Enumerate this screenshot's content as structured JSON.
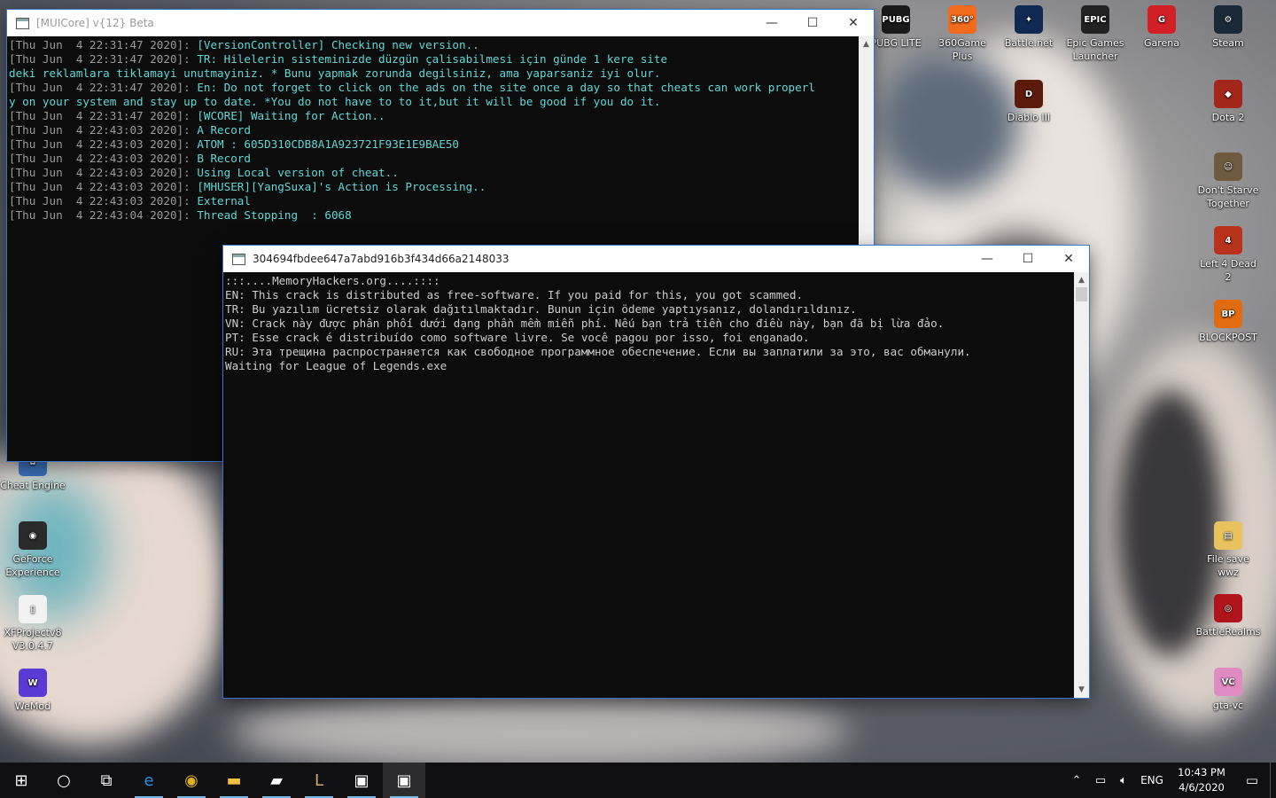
{
  "desktop": {
    "icons_right": [
      {
        "label": "PUBG LITE",
        "icon": "pubg-icon",
        "color": "#1a1a1a",
        "glyph": "PUBG"
      },
      {
        "label": "360Game Plus",
        "icon": "360game-icon",
        "color": "#f26a1b",
        "glyph": "360°"
      },
      {
        "label": "Battle.net",
        "icon": "battlenet-icon",
        "color": "#0e2a52",
        "glyph": "✦"
      },
      {
        "label": "Epic Games Launcher",
        "icon": "epic-games-icon",
        "color": "#222222",
        "glyph": "EPIC"
      },
      {
        "label": "Garena",
        "icon": "garena-icon",
        "color": "#d31f26",
        "glyph": "G"
      },
      {
        "label": "Steam",
        "icon": "steam-icon",
        "color": "#1b2838",
        "glyph": "⚙"
      },
      {
        "label": "Diablo III",
        "icon": "diablo-icon",
        "color": "#5b1a0c",
        "glyph": "D"
      },
      {
        "label": "Dota 2",
        "icon": "dota-icon",
        "color": "#a3261b",
        "glyph": "◆"
      },
      {
        "label": "Don't Starve Together",
        "icon": "dont-starve-icon",
        "color": "#6e5a3e",
        "glyph": "☺"
      },
      {
        "label": "Left 4 Dead 2",
        "icon": "left4dead-icon",
        "color": "#b8321c",
        "glyph": "4"
      },
      {
        "label": "BLOCKPOST",
        "icon": "blockpost-icon",
        "color": "#e06b10",
        "glyph": "BP"
      },
      {
        "label": "File save wwz",
        "icon": "folder-icon",
        "color": "#e8c25c",
        "glyph": "▤"
      },
      {
        "label": "BattleRealms",
        "icon": "battlerealms-icon",
        "color": "#b0141a",
        "glyph": "◎"
      },
      {
        "label": "gta-vc",
        "icon": "gta-vc-icon",
        "color": "#e18bc4",
        "glyph": "VC"
      }
    ],
    "icons_left": [
      {
        "label": "Cheat Engine",
        "icon": "cheat-engine-icon",
        "color": "#3a6fb8",
        "glyph": "✿"
      },
      {
        "label": "GeForce Experience",
        "icon": "geforce-icon",
        "color": "#2a2a2a",
        "glyph": "◉"
      },
      {
        "label": "XFProjectv8 V3.0.4.7",
        "icon": "file-icon",
        "color": "#f2f2f2",
        "glyph": "▯"
      },
      {
        "label": "WeMod",
        "icon": "wemod-icon",
        "color": "#5b3bd6",
        "glyph": "W"
      }
    ]
  },
  "window1": {
    "title": "[MUICore] v{12} Beta",
    "lines": [
      {
        "ts": "[Thu Jun  4 22:31:47 2020]: ",
        "msg": "[VersionController] Checking new version.."
      },
      {
        "ts": "[Thu Jun  4 22:31:47 2020]: ",
        "msg": "TR: Hilelerin sisteminizde düzgün çalisabilmesi için günde 1 kere site"
      },
      {
        "ts": "",
        "msg": "deki reklamlara tiklamayi unutmayiniz. * Bunu yapmak zorunda degilsiniz, ama yaparsaniz iyi olur."
      },
      {
        "ts": "[Thu Jun  4 22:31:47 2020]: ",
        "msg": "En: Do not forget to click on the ads on the site once a day so that cheats can work properl"
      },
      {
        "ts": "",
        "msg": "y on your system and stay up to date. *You do not have to to it,but it will be good if you do it."
      },
      {
        "ts": "[Thu Jun  4 22:31:47 2020]: ",
        "msg": "[WCORE] Waiting for Action.."
      },
      {
        "ts": "[Thu Jun  4 22:43:03 2020]: ",
        "msg": "A Record"
      },
      {
        "ts": "[Thu Jun  4 22:43:03 2020]: ",
        "msg": "ATOM : 605D310CDB8A1A923721F93E1E9BAE50"
      },
      {
        "ts": "[Thu Jun  4 22:43:03 2020]: ",
        "msg": "B Record"
      },
      {
        "ts": "[Thu Jun  4 22:43:03 2020]: ",
        "msg": "Using Local version of cheat.."
      },
      {
        "ts": "[Thu Jun  4 22:43:03 2020]: ",
        "msg": "[MHUSER][YangSuxa]'s Action is Processing.."
      },
      {
        "ts": "[Thu Jun  4 22:43:03 2020]: ",
        "msg": "External"
      },
      {
        "ts": "[Thu Jun  4 22:43:04 2020]: ",
        "msg": "Thread Stopping  : 6068"
      }
    ]
  },
  "window2": {
    "title": "304694fbdee647a7abd916b3f434d66a2148033",
    "lines": [
      ":::....MemoryHackers.org....::::",
      "EN: This crack is distributed as free-software. If you paid for this, you got scammed.",
      "TR: Bu yazılım ücretsiz olarak dağıtılmaktadır. Bunun için ödeme yaptıysanız, dolandırıldınız.",
      "VN: Crack này được phân phối dưới dạng phần mềm miễn phí. Nếu bạn trả tiền cho điều này, bạn đã bị lừa đảo.",
      "PT: Esse crack é distribuído como software livre. Se você pagou por isso, foi enganado.",
      "RU: Эта трещина распространяется как свободное программное обеспечение. Если вы заплатили за это, вас обманули.",
      "Waiting for League of Legends.exe"
    ]
  },
  "window_controls": {
    "minimize": "—",
    "maximize": "☐",
    "close": "✕"
  },
  "taskbar": {
    "items": [
      {
        "name": "start-button",
        "glyph": "⊞"
      },
      {
        "name": "search-button",
        "glyph": "○"
      },
      {
        "name": "task-view-button",
        "glyph": "⧉"
      },
      {
        "name": "edge-taskbar-icon",
        "glyph": "e"
      },
      {
        "name": "chrome-taskbar-icon",
        "glyph": "◉"
      },
      {
        "name": "file-explorer-taskbar-icon",
        "glyph": "▬"
      },
      {
        "name": "notes-taskbar-icon",
        "glyph": "▰"
      },
      {
        "name": "league-taskbar-icon",
        "glyph": "L"
      },
      {
        "name": "console-taskbar-icon-1",
        "glyph": "▣"
      },
      {
        "name": "console-taskbar-icon-2",
        "glyph": "▣"
      }
    ],
    "tray": {
      "language": "ENG",
      "time": "10:43 PM",
      "date": "4/6/2020"
    }
  }
}
